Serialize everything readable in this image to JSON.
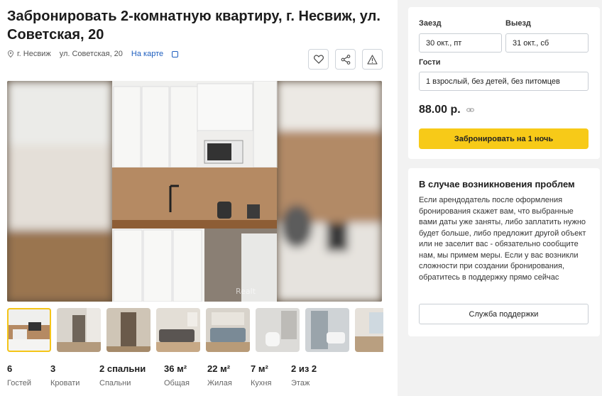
{
  "listing": {
    "title": "Забронировать 2-комнатную квартиру, г. Несвиж, ул. Советская, 20",
    "city": "г. Несвиж",
    "street": "ул. Советская, 20",
    "map_link": "На карте"
  },
  "icons": {
    "location": "pin-icon",
    "copy": "copy-icon",
    "favorite": "heart-icon",
    "share": "share-icon",
    "report": "warning-icon",
    "price_link": "link-icon"
  },
  "photo_watermark": "Realt",
  "thumbnails": [
    {
      "name": "kitchen",
      "active": true
    },
    {
      "name": "hallway"
    },
    {
      "name": "door"
    },
    {
      "name": "living-room"
    },
    {
      "name": "sofa"
    },
    {
      "name": "bathroom"
    },
    {
      "name": "shower"
    },
    {
      "name": "window"
    }
  ],
  "stats": [
    {
      "value": "6",
      "label": "Гостей"
    },
    {
      "value": "3",
      "label": "Кровати"
    },
    {
      "value": "2 спальни",
      "label": "Спальни"
    },
    {
      "value": "36 м²",
      "label": "Общая"
    },
    {
      "value": "22 м²",
      "label": "Жилая"
    },
    {
      "value": "7 м²",
      "label": "Кухня"
    },
    {
      "value": "2 из 2",
      "label": "Этаж"
    }
  ],
  "booking": {
    "checkin_label": "Заезд",
    "checkin_value": "30 окт., пт",
    "checkout_label": "Выезд",
    "checkout_value": "31 окт., сб",
    "guests_label": "Гости",
    "guests_value": "1 взрослый, без детей, без питомцев",
    "price": "88.00 р.",
    "book_button": "Забронировать на 1 ночь"
  },
  "help": {
    "title": "В случае возникновения проблем",
    "text": "Если арендодатель после оформления бронирования скажет вам, что выбранные вами даты уже заняты, либо заплатить нужно будет больше, либо предложит другой объект или не заселит вас - обязательно сообщите нам, мы примем меры. Если у вас возникли сложности при создании бронирования, обратитесь в поддержку прямо сейчас",
    "support_button": "Служба поддержки"
  },
  "colors": {
    "accent_yellow": "#f7ca18",
    "link_blue": "#1f5fbf",
    "page_bg": "#f2f2f2"
  }
}
